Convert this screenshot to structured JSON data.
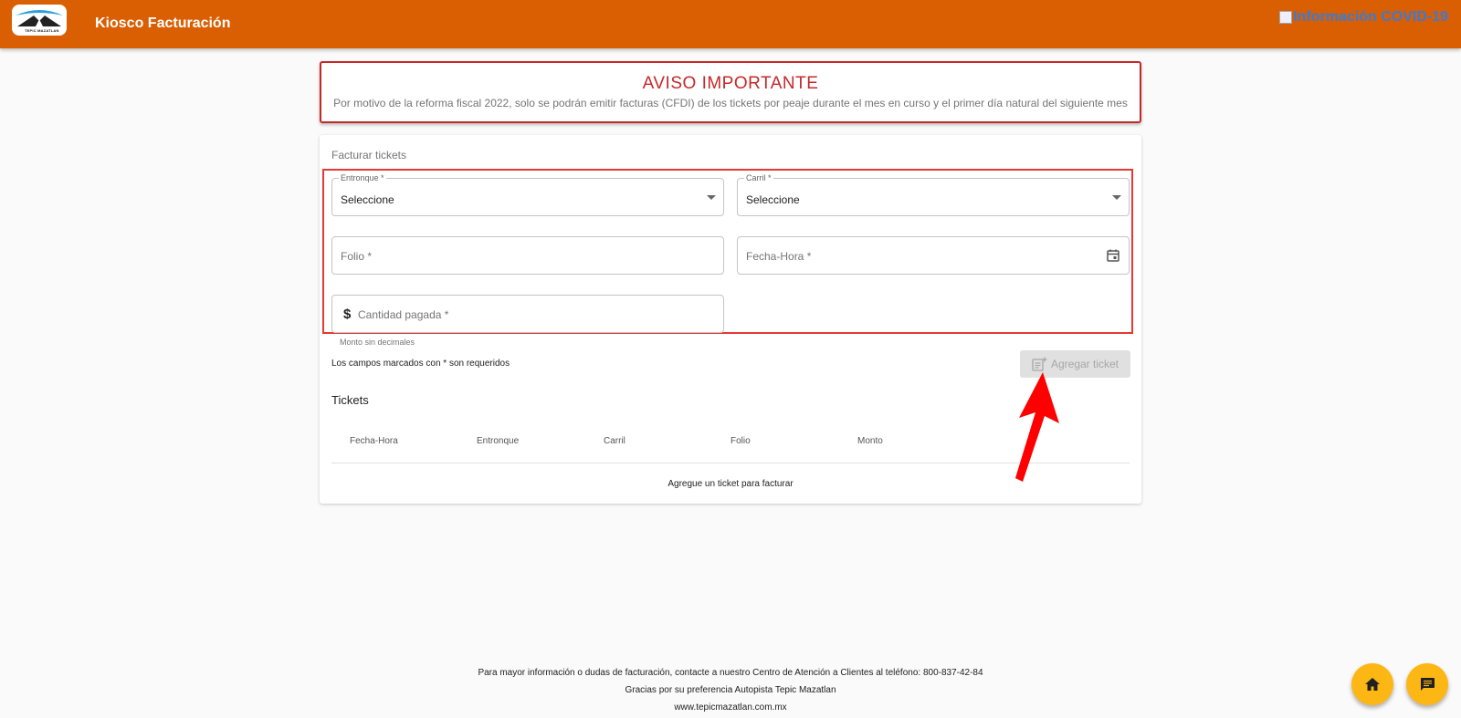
{
  "header": {
    "logo_text": "TEPIC MAZATLAN",
    "title": "Kiosco Facturación",
    "covid_link": "Información COVID-19"
  },
  "notice": {
    "title": "AVISO IMPORTANTE",
    "text": "Por motivo de la reforma fiscal 2022, solo se podrán emitir facturas (CFDI) de los tickets por peaje durante el mes en curso y el primer día natural del siguiente mes"
  },
  "form": {
    "card_title": "Facturar tickets",
    "entronque": {
      "label": "Entronque *",
      "value": "Seleccione"
    },
    "carril": {
      "label": "Carril *",
      "value": "Seleccione"
    },
    "folio": {
      "placeholder": "Folio *"
    },
    "fecha_hora": {
      "placeholder": "Fecha-Hora *"
    },
    "cantidad": {
      "placeholder": "Cantidad pagada *",
      "helper": "Monto sin decimales"
    },
    "required_note": "Los campos marcados con * son requeridos",
    "add_button": "Agregar ticket"
  },
  "tickets": {
    "title": "Tickets",
    "columns": [
      "Fecha-Hora",
      "Entronque",
      "Carril",
      "Folio",
      "Monto"
    ],
    "empty_message": "Agregue un ticket para facturar"
  },
  "footer": {
    "contact": "Para mayor información o dudas de facturación, contacte a nuestro Centro de Atención a Clientes al teléfono: 800-837-42-84",
    "thanks": "Gracias por su preferencia Autopista Tepic Mazatlan",
    "website": "www.tepicmazatlan.com.mx"
  },
  "colors": {
    "header_bg": "#d95f02",
    "notice_red": "#c62828",
    "fab_yellow": "#fdb715",
    "annotation_red": "#e53935"
  }
}
